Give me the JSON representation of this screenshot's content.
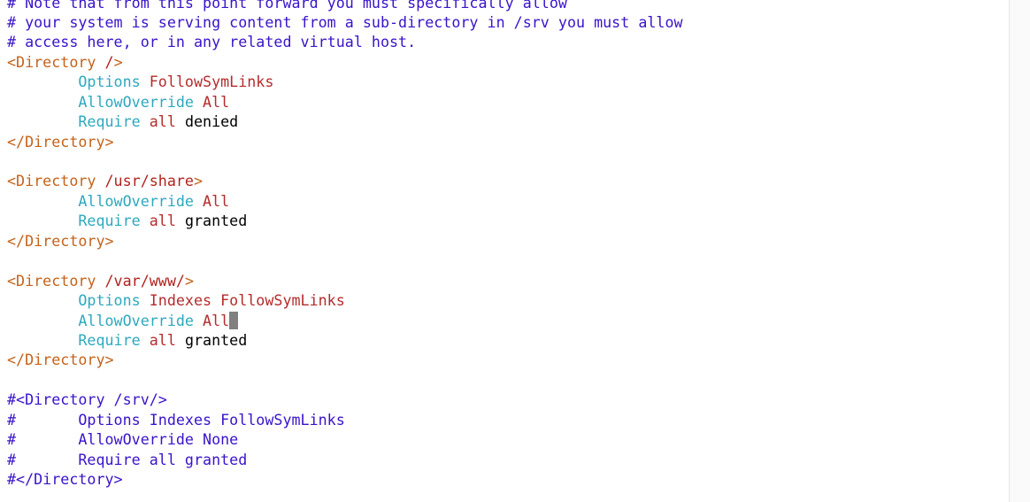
{
  "colors": {
    "comment": "#3a13c9",
    "tag": "#c4621a",
    "path": "#b0231d",
    "directive": "#2ea8be",
    "value": "#b42c2c",
    "plain": "#000000",
    "cursor": "#808080",
    "background": "#ffffff"
  },
  "lines": [
    [
      {
        "t": "# Note that from this point forward you must specifically allow",
        "c": "comment"
      }
    ],
    [
      {
        "t": "# your system is serving content from a sub-directory in /srv you must allow",
        "c": "comment"
      }
    ],
    [
      {
        "t": "# access here, or in any related virtual host.",
        "c": "comment"
      }
    ],
    [
      {
        "t": "<Directory ",
        "c": "tag"
      },
      {
        "t": "/",
        "c": "path"
      },
      {
        "t": ">",
        "c": "tag"
      }
    ],
    [
      {
        "t": "        "
      },
      {
        "t": "Options",
        "c": "directive"
      },
      {
        "t": " "
      },
      {
        "t": "FollowSymLinks",
        "c": "value"
      }
    ],
    [
      {
        "t": "        "
      },
      {
        "t": "AllowOverride",
        "c": "directive"
      },
      {
        "t": " "
      },
      {
        "t": "All",
        "c": "value"
      }
    ],
    [
      {
        "t": "        "
      },
      {
        "t": "Require",
        "c": "directive"
      },
      {
        "t": " "
      },
      {
        "t": "all",
        "c": "value"
      },
      {
        "t": " "
      },
      {
        "t": "denied",
        "c": "plain"
      }
    ],
    [
      {
        "t": "</Directory>",
        "c": "tag"
      }
    ],
    [],
    [
      {
        "t": "<Directory ",
        "c": "tag"
      },
      {
        "t": "/usr/share",
        "c": "path"
      },
      {
        "t": ">",
        "c": "tag"
      }
    ],
    [
      {
        "t": "        "
      },
      {
        "t": "AllowOverride",
        "c": "directive"
      },
      {
        "t": " "
      },
      {
        "t": "All",
        "c": "value"
      }
    ],
    [
      {
        "t": "        "
      },
      {
        "t": "Require",
        "c": "directive"
      },
      {
        "t": " "
      },
      {
        "t": "all",
        "c": "value"
      },
      {
        "t": " "
      },
      {
        "t": "granted",
        "c": "plain"
      }
    ],
    [
      {
        "t": "</Directory>",
        "c": "tag"
      }
    ],
    [],
    [
      {
        "t": "<Directory ",
        "c": "tag"
      },
      {
        "t": "/var/www/",
        "c": "path"
      },
      {
        "t": ">",
        "c": "tag"
      }
    ],
    [
      {
        "t": "        "
      },
      {
        "t": "Options",
        "c": "directive"
      },
      {
        "t": " "
      },
      {
        "t": "Indexes FollowSymLinks",
        "c": "value"
      }
    ],
    [
      {
        "t": "        "
      },
      {
        "t": "AllowOverride",
        "c": "directive"
      },
      {
        "t": " "
      },
      {
        "t": "All",
        "c": "value"
      },
      {
        "cursor": true
      }
    ],
    [
      {
        "t": "        "
      },
      {
        "t": "Require",
        "c": "directive"
      },
      {
        "t": " "
      },
      {
        "t": "all",
        "c": "value"
      },
      {
        "t": " "
      },
      {
        "t": "granted",
        "c": "plain"
      }
    ],
    [
      {
        "t": "</Directory>",
        "c": "tag"
      }
    ],
    [],
    [
      {
        "t": "#<Directory /srv/>",
        "c": "comment"
      }
    ],
    [
      {
        "t": "#       Options Indexes FollowSymLinks",
        "c": "comment"
      }
    ],
    [
      {
        "t": "#       AllowOverride None",
        "c": "comment"
      }
    ],
    [
      {
        "t": "#       Require all granted",
        "c": "comment"
      }
    ],
    [
      {
        "t": "#</Directory>",
        "c": "comment"
      }
    ]
  ]
}
